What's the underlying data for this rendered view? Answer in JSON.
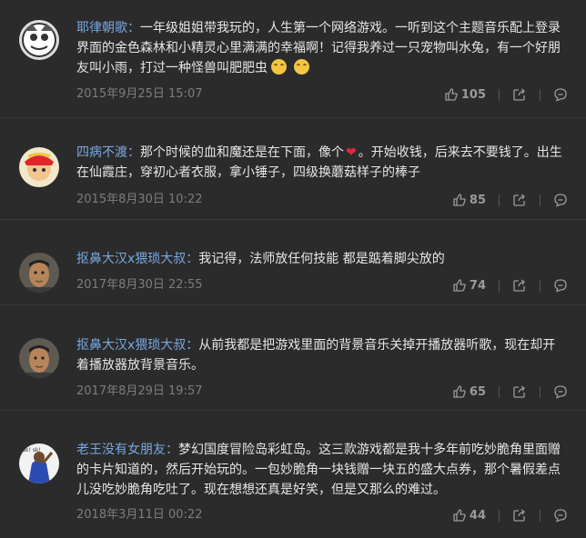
{
  "comments": [
    {
      "user": "耶律朝歌",
      "text": "一年级姐姐带我玩的，人生第一个网络游戏。一听到这个主题音乐配上登录界面的金色森林和小精灵心里满满的幸福啊！记得我养过一只宠物叫水兔，有一个好朋友叫小雨，打过一种怪兽叫肥肥虫",
      "time": "2015年9月25日 15:07",
      "likes": "105",
      "emoji": "crying-face-icon"
    },
    {
      "user": "四病不渡",
      "text_before": "那个时候的血和魔还是在下面，像个",
      "text_after": "。开始收钱，后来去不要钱了。出生在仙霞庄，穿初心者衣服，拿小锤子，四级换蘑菇样子的棒子",
      "time": "2015年8月30日 10:22",
      "likes": "85",
      "emoji": "heart-icon"
    },
    {
      "user": "抠鼻大汉x猥琐大叔",
      "text": "我记得，法师放任何技能 都是踮着脚尖放的",
      "time": "2017年8月30日 22:55",
      "likes": "74"
    },
    {
      "user": "抠鼻大汉x猥琐大叔",
      "text": "从前我都是把游戏里面的背景音乐关掉开播放器听歌，现在却开着播放器放背景音乐。",
      "time": "2017年8月29日 19:57",
      "likes": "65"
    },
    {
      "user": "老王没有女朋友",
      "text": "梦幻国度冒险岛彩虹岛。这三款游戏都是我十多年前吃妙脆角里面赠的卡片知道的，然后开始玩的。一包妙脆角一块钱赠一块五的盛大点券，那个暑假差点儿没吃妙脆角吃吐了。现在想想还真是好笑，但是又那么的难过。",
      "time": "2018年3月11日 00:22",
      "likes": "44"
    }
  ],
  "colon": "：",
  "colors": {
    "background": "#2b2b2b",
    "username": "#77a8e0",
    "text": "#e6e6e6",
    "meta": "#7d7d7d"
  }
}
